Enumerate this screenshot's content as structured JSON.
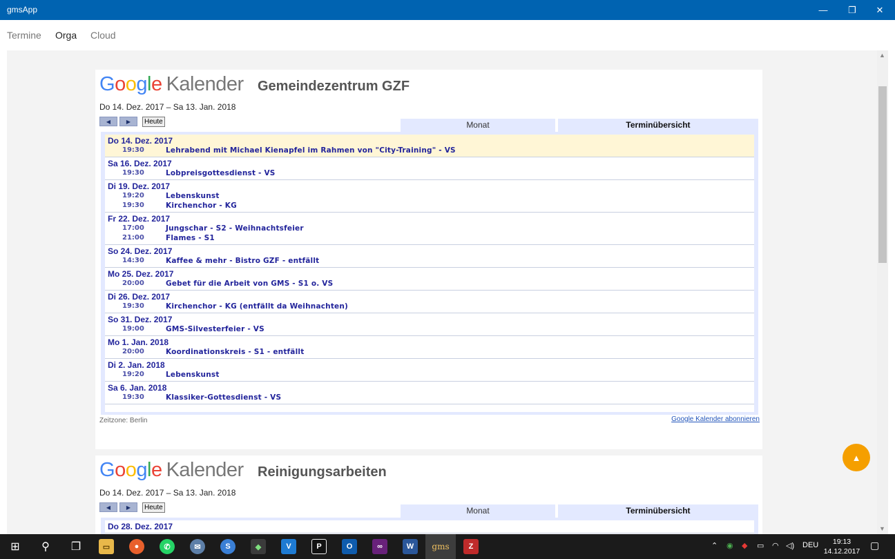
{
  "window": {
    "title": "gmsApp"
  },
  "nav": {
    "items": [
      "Termine",
      "Orga",
      "Cloud"
    ],
    "active": "Orga"
  },
  "calendars": [
    {
      "logo": "Google Kalender",
      "title": "Gemeindezentrum GZF",
      "date_range": "Do 14. Dez. 2017 – Sa 13. Jan. 2018",
      "today_button": "Heute",
      "tabs": [
        "Monat",
        "Terminübersicht"
      ],
      "timezone": "Zeitzone: Berlin",
      "subscribe": "Google Kalender abonnieren",
      "days": [
        {
          "date": "Do 14. Dez. 2017",
          "today": true,
          "events": [
            {
              "time": "19:30",
              "title": "Lehrabend mit Michael Kienapfel im Rahmen von \"City-Training\" - VS"
            }
          ]
        },
        {
          "date": "Sa 16. Dez. 2017",
          "events": [
            {
              "time": "19:30",
              "title": "Lobpreisgottesdienst - VS"
            }
          ]
        },
        {
          "date": "Di 19. Dez. 2017",
          "events": [
            {
              "time": "19:20",
              "title": "Lebenskunst"
            },
            {
              "time": "19:30",
              "title": "Kirchenchor - KG"
            }
          ]
        },
        {
          "date": "Fr 22. Dez. 2017",
          "events": [
            {
              "time": "17:00",
              "title": "Jungschar - S2 - Weihnachtsfeier"
            },
            {
              "time": "21:00",
              "title": "Flames - S1"
            }
          ]
        },
        {
          "date": "So 24. Dez. 2017",
          "events": [
            {
              "time": "14:30",
              "title": "Kaffee & mehr - Bistro GZF - entfällt"
            }
          ]
        },
        {
          "date": "Mo 25. Dez. 2017",
          "events": [
            {
              "time": "20:00",
              "title": "Gebet für die Arbeit von GMS - S1 o. VS"
            }
          ]
        },
        {
          "date": "Di 26. Dez. 2017",
          "events": [
            {
              "time": "19:30",
              "title": "Kirchenchor - KG (entfällt da Weihnachten)"
            }
          ]
        },
        {
          "date": "So 31. Dez. 2017",
          "events": [
            {
              "time": "19:00",
              "title": "GMS-Silvesterfeier - VS"
            }
          ]
        },
        {
          "date": "Mo 1. Jan. 2018",
          "events": [
            {
              "time": "20:00",
              "title": "Koordinationskreis - S1 - entfällt"
            }
          ]
        },
        {
          "date": "Di 2. Jan. 2018",
          "events": [
            {
              "time": "19:20",
              "title": "Lebenskunst"
            }
          ]
        },
        {
          "date": "Sa 6. Jan. 2018",
          "events": [
            {
              "time": "19:30",
              "title": "Klassiker-Gottesdienst - VS"
            }
          ]
        }
      ]
    },
    {
      "logo": "Google Kalender",
      "title": "Reinigungsarbeiten",
      "date_range": "Do 14. Dez. 2017 – Sa 13. Jan. 2018",
      "today_button": "Heute",
      "tabs": [
        "Monat",
        "Terminübersicht"
      ],
      "days": [
        {
          "date": "Do 28. Dez. 2017",
          "events": []
        }
      ]
    }
  ],
  "taskbar": {
    "apps": [
      "windows-start",
      "search",
      "task-view",
      "file-explorer",
      "firefox",
      "whatsapp",
      "mail",
      "browser",
      "git",
      "vs-code",
      "jetbrains",
      "outlook",
      "visual-studio",
      "word",
      "gms",
      "filezilla"
    ],
    "active_label": "gms",
    "language": "DEU",
    "time": "19:13",
    "date": "14.12.2017"
  },
  "colors": {
    "titlebar": "#0063b1",
    "accent": "#f59f00",
    "event_text": "#22249b",
    "today_row": "#fff6d6"
  }
}
